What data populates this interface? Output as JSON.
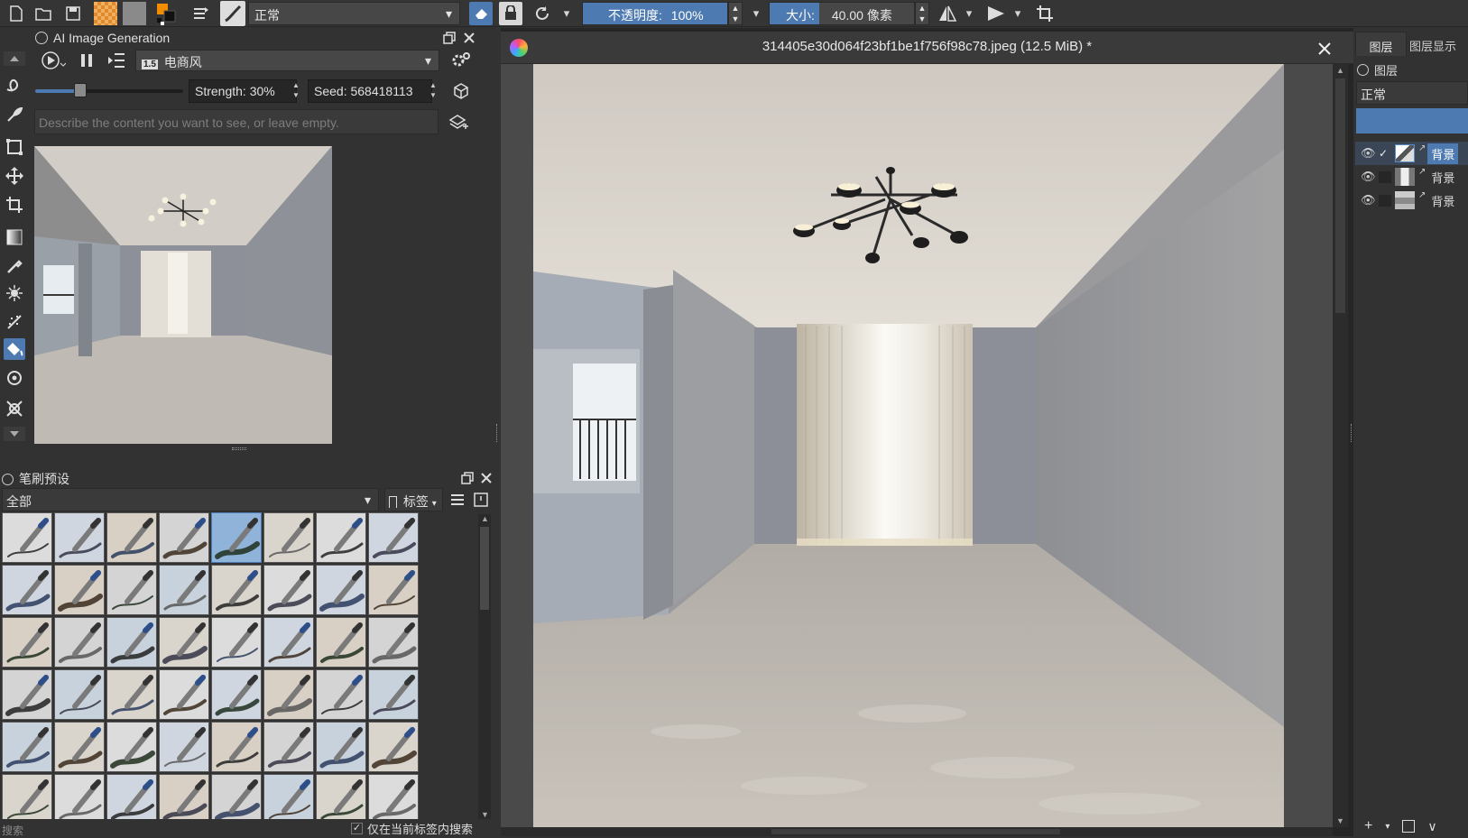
{
  "toolbar": {
    "blend_mode": "正常",
    "opacity_label": "不透明度:",
    "opacity_value": "100%",
    "size_label": "大小:",
    "size_value": "40.00 像素"
  },
  "ai_docker": {
    "title": "AI Image Generation",
    "style_name": "电商风",
    "strength": "Strength: 30%",
    "seed": "Seed: 568418113",
    "prompt_placeholder": "Describe the content you want to see, or leave empty."
  },
  "brush_docker": {
    "title": "笔刷预设",
    "filter": "全部",
    "tag_label": "标签",
    "search_label": "搜索",
    "checkbox_label": "仅在当前标签内搜索"
  },
  "document": {
    "tab_title": "314405e30d064f23bf1be1f756f98c78.jpeg (12.5 MiB) *"
  },
  "layers_panel": {
    "tab_layers": "图层",
    "tab_display": "图层显示",
    "header": "图层",
    "blend_mode": "正常",
    "layers": [
      {
        "name": "背景",
        "checked": true
      },
      {
        "name": "背景",
        "checked": false
      },
      {
        "name": "背景",
        "checked": false
      }
    ]
  },
  "colors": {
    "accent": "#4d7ab0",
    "foreground": "#f28c00",
    "background": "#1a1a1a"
  }
}
